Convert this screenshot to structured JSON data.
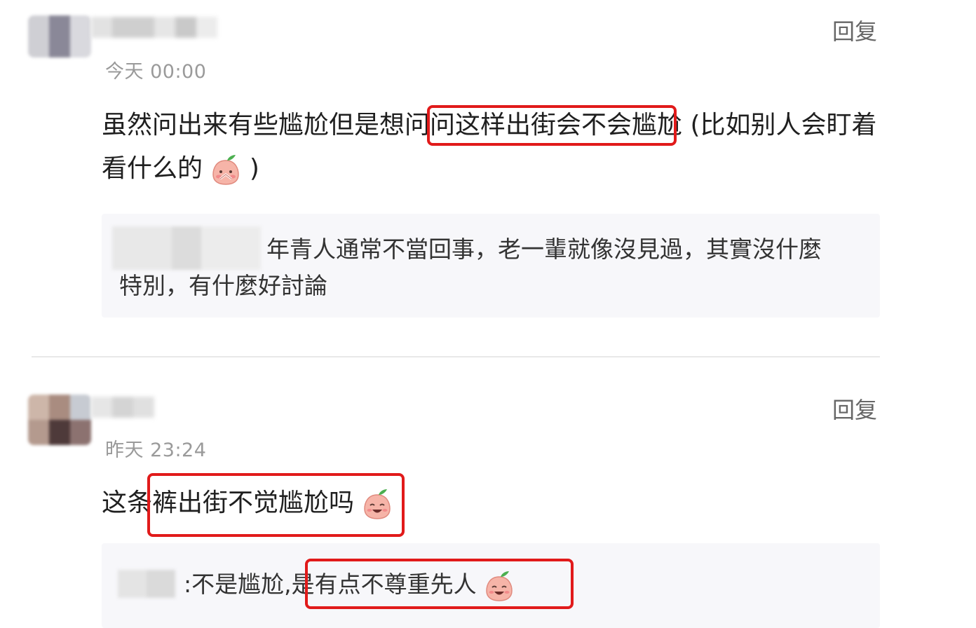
{
  "comments": [
    {
      "time": "今天 00:00",
      "reply_label": "回复",
      "text_part1": "虽然问出来有些尴尬但是想问问",
      "text_highlight": "这样出街会不会尴尬",
      "text_part2": "(比如别人会盯着",
      "text_line2": "看什么的",
      "text_close": ")",
      "emoji": "peach-face-shy-icon",
      "quote": {
        "line1": "年青人通常不當回事，老一輩就像沒見過，其實沒什麼",
        "line2": "特別，有什麼好討論"
      }
    },
    {
      "time": "昨天 23:24",
      "reply_label": "回复",
      "text_prefix": "这条",
      "text_highlight": "裤出街不觉尴尬吗",
      "emoji": "peach-face-laugh-icon",
      "quote": {
        "prefix": ":",
        "text_part1": "不是尴尬,",
        "text_highlight": "是有点不尊重先人",
        "emoji": "peach-face-laugh-icon"
      }
    }
  ],
  "colors": {
    "highlight_border": "#e11a1a",
    "time_text": "#9a9a9a",
    "quote_bg": "#f7f7fa"
  }
}
